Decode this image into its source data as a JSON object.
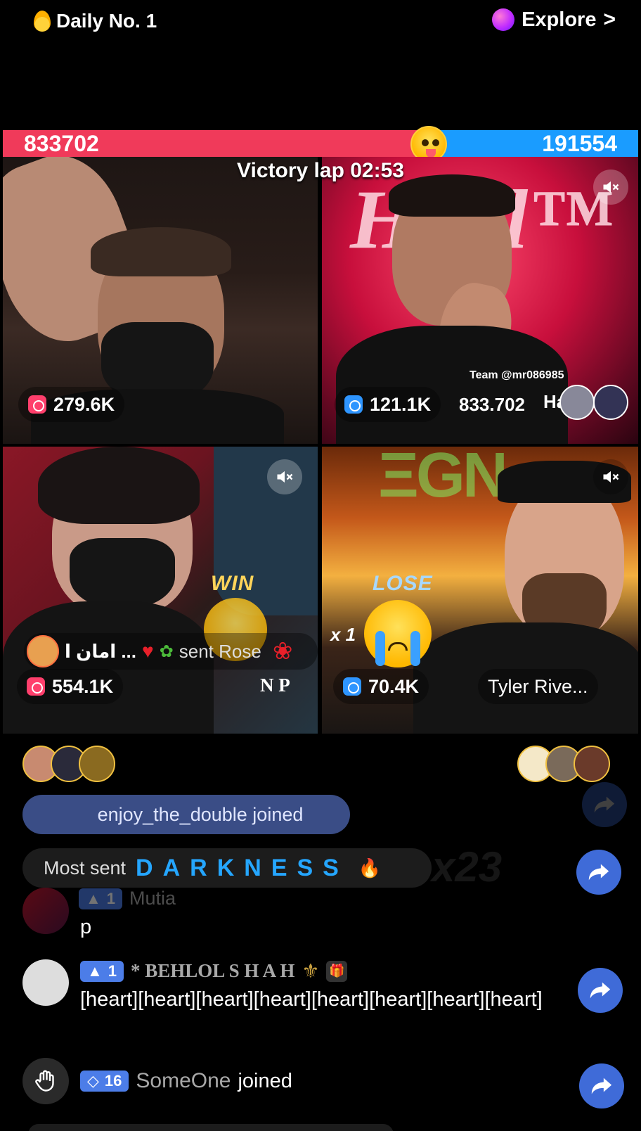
{
  "header": {
    "daily_label": "Daily No. 1",
    "explore_label": "Explore",
    "explore_chevron": ">"
  },
  "battle": {
    "left_score": "833702",
    "right_score": "191554",
    "left_color": "#f03a5a",
    "right_color": "#1a9cff",
    "status": "Victory lap 02:53"
  },
  "tiles": [
    {
      "gift_count": "279.6K",
      "gift_color": "#ff3f6c"
    },
    {
      "gift_count": "121.1K",
      "gift_color": "#2e95ff",
      "team_label": "Team @mr086985",
      "team_score": "833.702",
      "team_name": "Halil"
    },
    {
      "gift_count": "554.1K",
      "gift_color": "#ff3f6c",
      "result": "WIN",
      "name": "N P"
    },
    {
      "gift_count": "70.4K",
      "gift_color": "#2e95ff",
      "result": "LOSE",
      "multiplier": "x 1",
      "name": "Tyler Rive..."
    }
  ],
  "gift_toast": {
    "sender": "امان ا ...",
    "text": "sent Rose"
  },
  "chat": {
    "joined_banner": "enjoy_the_double joined",
    "most_sent_label": "Most sent",
    "most_sent_name": "DARKNESS",
    "faded_combo": "x23",
    "faded_name": "Mutia",
    "faded_level": "1",
    "messages": [
      {
        "level": "1",
        "name": "p",
        "text": ""
      },
      {
        "level": "1",
        "name": "* BEHLOL S H A H",
        "text": "[heart][heart][heart][heart][heart][heart][heart][heart]"
      },
      {
        "level": "16",
        "name": "SomeOne",
        "text": "joined"
      }
    ]
  }
}
